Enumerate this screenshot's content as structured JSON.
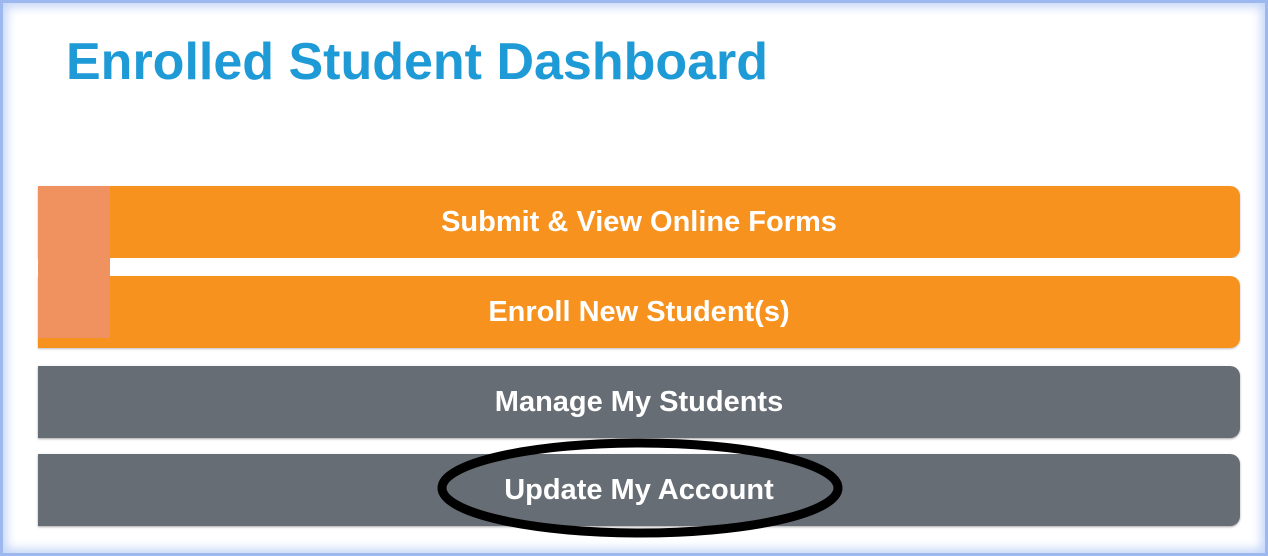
{
  "page": {
    "title": "Enrolled Student Dashboard"
  },
  "buttons": {
    "submit_forms": "Submit & View Online Forms",
    "enroll_new": "Enroll New Student(s)",
    "manage_students": "Manage My Students",
    "update_account": "Update My Account"
  },
  "colors": {
    "title": "#1e9ad6",
    "orange_button": "#f7921e",
    "gray_button": "#676d74",
    "accent_block": "#f0925f",
    "highlight_ring": "#000000"
  },
  "annotation": {
    "highlight_target": "update_account"
  }
}
